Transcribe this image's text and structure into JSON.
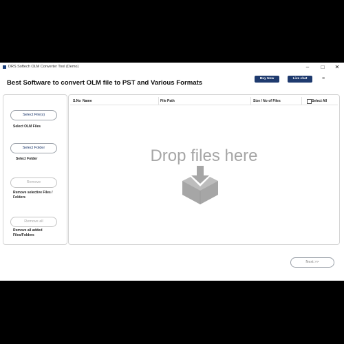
{
  "window": {
    "title": "DRS Softech OLM Converter Tool (Demo)",
    "controls": {
      "minimize": "–",
      "maximize": "□",
      "close": "✕"
    }
  },
  "header": {
    "title": "Best Software to convert OLM file to PST and Various Formats",
    "buy_now": "Buy Now",
    "live_chat": "Live chat",
    "menu_icon": "≡"
  },
  "sidebar": {
    "select_files_button": "Select File(s)",
    "select_files_label": "Select OLM Files",
    "select_folder_button": "Select Folder",
    "select_folder_label": "Select Folder",
    "remove_button": "Remove",
    "remove_label": "Remove selective Files / Folders",
    "remove_all_button": "Remove all",
    "remove_all_label": "Remove all added Files/Folders"
  },
  "table": {
    "columns": [
      "S.No",
      "Name",
      "File Path",
      "Size / No of Files"
    ],
    "select_all": "Select All",
    "drop_text": "Drop files here"
  },
  "footer": {
    "next_button": "Next >>"
  },
  "colors": {
    "accent": "#1e3a6e",
    "placeholder": "#a6a6a6"
  },
  "icons": [
    "app-icon",
    "minimize-icon",
    "maximize-icon",
    "close-icon",
    "menu-icon",
    "drop-box-icon"
  ]
}
